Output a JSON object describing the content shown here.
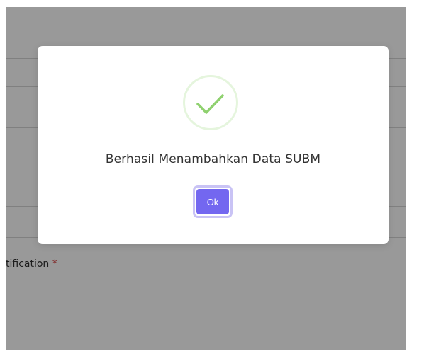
{
  "background_form": {
    "partial_label": "tification",
    "required_mark": "*"
  },
  "modal": {
    "message": "Berhasil Menambahkan Data SUBM",
    "ok_label": "Ok",
    "icon": "check-icon"
  },
  "colors": {
    "accent": "#7367f0",
    "success": "#8fd16f",
    "required": "#d63a3a",
    "overlay": "rgba(0,0,0,0.40)"
  }
}
